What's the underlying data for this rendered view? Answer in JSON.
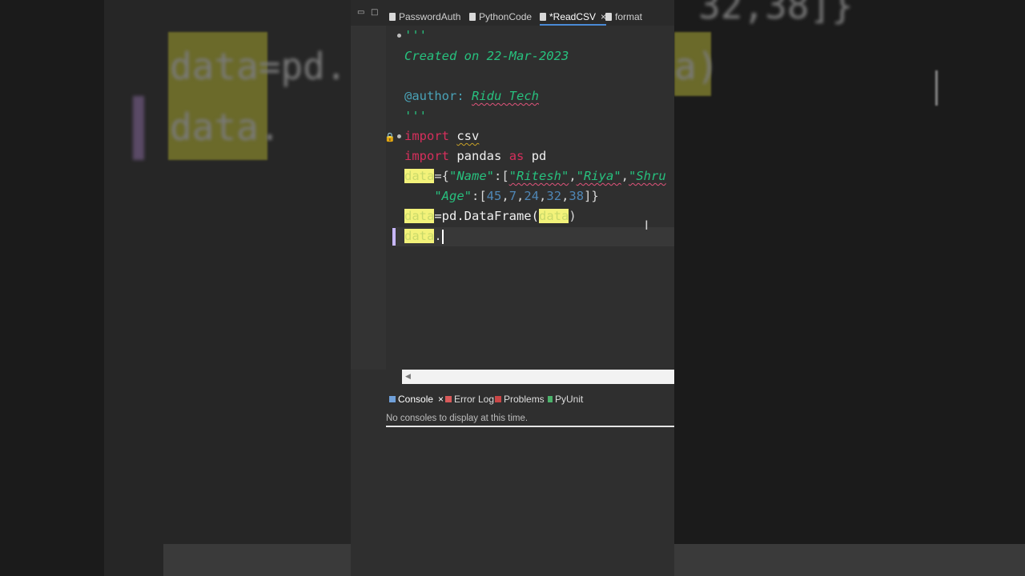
{
  "tabs": [
    {
      "label": "PasswordAuth",
      "active": false
    },
    {
      "label": "PythonCode",
      "active": false
    },
    {
      "label": "*ReadCSV",
      "active": true
    },
    {
      "label": "format",
      "active": false
    }
  ],
  "window_controls": {
    "minimize": "▭",
    "maximize": "□"
  },
  "editor": {
    "docstring_open": "'''",
    "created": "Created on 22-Mar-2023",
    "author_tag": "@author:",
    "author_name": "Ridu Tech",
    "docstring_close": "'''",
    "import1_kw": "import",
    "import1_mod": "csv",
    "import2_kw": "import",
    "import2_mod": "pandas",
    "import2_as": "as",
    "import2_alias": "pd",
    "var_data": "data",
    "dict_open": "={",
    "key_name": "\"Name\"",
    "colon_bracket": ":[",
    "val_ritesh": "\"Ritesh\"",
    "comma": ",",
    "val_riya": "\"Riya\"",
    "val_shru": "\"Shru",
    "key_age": "\"Age\"",
    "ages": [
      "45",
      "7",
      "24",
      "32",
      "38"
    ],
    "age_close": "]}",
    "df_assign": "=pd.DataFrame(",
    "df_arg": "data",
    "df_close": ")",
    "last_var": "data",
    "last_dot": "."
  },
  "panel": {
    "tabs": [
      {
        "label": "Console",
        "active": true
      },
      {
        "label": "Error Log"
      },
      {
        "label": "Problems"
      },
      {
        "label": "PyUnit"
      }
    ],
    "close_glyph": "×",
    "message": "No consoles to display at this time."
  },
  "background": {
    "zoom_line1_a": "data",
    "zoom_line1_b": "=pd.",
    "zoom_line2": "data.",
    "zoom_top": "32,38]}",
    "zoom_right": "a)"
  },
  "colors": {
    "keyword": "#d62f5c",
    "string": "#27c17e",
    "number": "#4f86b5",
    "highlight": "#f3f27a",
    "active_tab_underline": "#4a8ad6"
  }
}
